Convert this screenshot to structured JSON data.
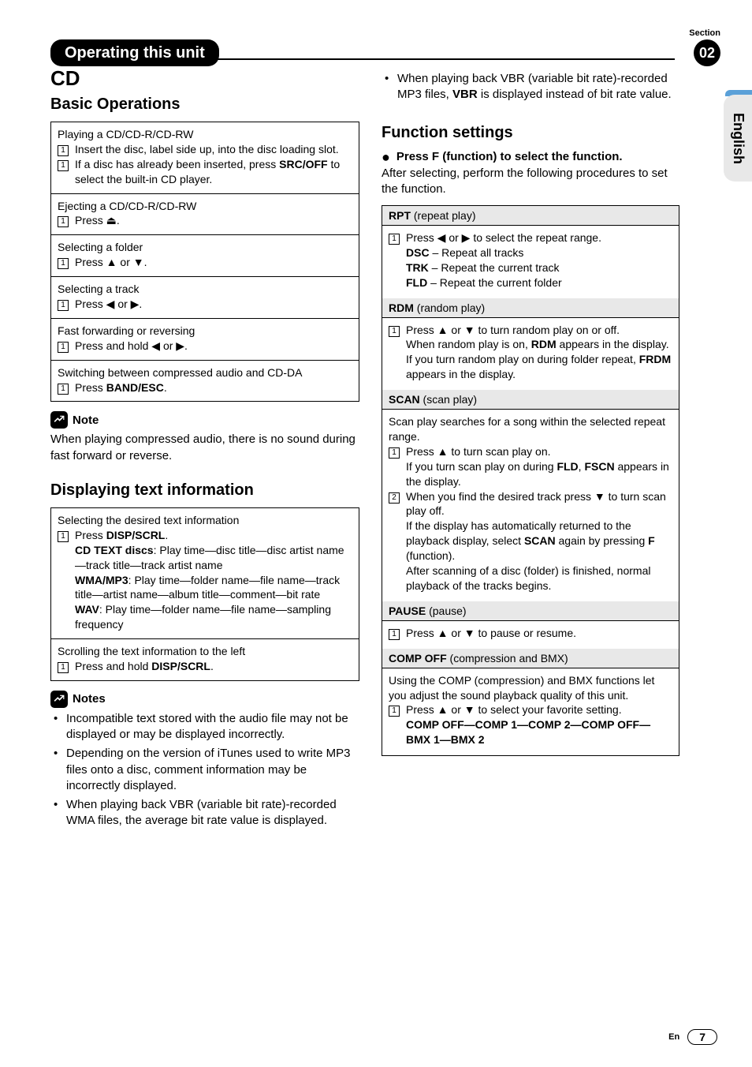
{
  "header": {
    "title": "Operating this unit",
    "section_label": "Section",
    "section_num": "02"
  },
  "sidetab": "English",
  "left": {
    "h1": "CD",
    "h2a": "Basic Operations",
    "box1": {
      "r1_title": "Playing a CD/CD-R/CD-RW",
      "r1_s1": "Insert the disc, label side up, into the disc loading slot.",
      "r1_s2a": "If a disc has already been inserted, press ",
      "r1_s2b": "SRC/OFF",
      "r1_s2c": " to select the built-in CD player.",
      "r2_title": "Ejecting a CD/CD-R/CD-RW",
      "r2_s1": "Press ⏏.",
      "r3_title": "Selecting a folder",
      "r3_s1": "Press ▲ or ▼.",
      "r4_title": "Selecting a track",
      "r4_s1": "Press ◀ or ▶.",
      "r5_title": "Fast forwarding or reversing",
      "r5_s1": "Press and hold ◀ or ▶.",
      "r6_title": "Switching between compressed audio and CD-DA",
      "r6_s1a": "Press ",
      "r6_s1b": "BAND/ESC",
      "r6_s1c": "."
    },
    "note1_label": "Note",
    "note1_body": "When playing compressed audio, there is no sound during fast forward or reverse.",
    "h2b": "Displaying text information",
    "box2": {
      "r1_title": "Selecting the desired text information",
      "r1_s1a": "Press ",
      "r1_s1b": "DISP/SCRL",
      "r1_s1c": ".",
      "r1_l1a": "CD TEXT discs",
      "r1_l1b": ": Play time—disc title—disc artist name—track title—track artist name",
      "r1_l2a": "WMA/MP3",
      "r1_l2b": ": Play time—folder name—file name—track title—artist name—album title—comment—bit rate",
      "r1_l3a": "WAV",
      "r1_l3b": ": Play time—folder name—file name—sampling frequency",
      "r2_title": "Scrolling the text information to the left",
      "r2_s1a": "Press and hold ",
      "r2_s1b": "DISP/SCRL",
      "r2_s1c": "."
    },
    "notes_label": "Notes",
    "notes": [
      "Incompatible text stored with the audio file may not be displayed or may be displayed incorrectly.",
      "Depending on the version of iTunes used to write MP3 files onto a disc, comment information may be incorrectly displayed.",
      "When playing back VBR (variable bit rate)-recorded WMA files, the average bit rate value is displayed."
    ]
  },
  "right": {
    "top_bullet_a": "When playing back VBR (variable bit rate)-recorded MP3 files, ",
    "top_bullet_b": "VBR",
    "top_bullet_c": " is displayed instead of bit rate value.",
    "h2": "Function settings",
    "fhead": "Press F (function) to select the function.",
    "fbody": "After selecting, perform the following procedures to set the function.",
    "rpt": {
      "bar_a": "RPT",
      "bar_b": " (repeat play)",
      "s1": "Press ◀ or ▶ to select the repeat range.",
      "l1a": "DSC",
      "l1b": " – Repeat all tracks",
      "l2a": "TRK",
      "l2b": " – Repeat the current track",
      "l3a": "FLD",
      "l3b": " – Repeat the current folder"
    },
    "rdm": {
      "bar_a": "RDM",
      "bar_b": " (random play)",
      "s1": "Press ▲ or ▼ to turn random play on or off.",
      "s1b_a": "When random play is on, ",
      "s1b_b": "RDM",
      "s1b_c": " appears in the display.",
      "s1c_a": "If you turn random play on during folder repeat, ",
      "s1c_b": "FRDM",
      "s1c_c": " appears in the display."
    },
    "scan": {
      "bar_a": "SCAN",
      "bar_b": " (scan play)",
      "intro": "Scan play searches for a song within the selected repeat range.",
      "s1": "Press ▲ to turn scan play on.",
      "s1b_a": "If you turn scan play on during ",
      "s1b_b": "FLD",
      "s1b_c": ", ",
      "s1b_d": "FSCN",
      "s1b_e": " appears in the display.",
      "s2": "When you find the desired track press ▼ to turn scan play off.",
      "s2b_a": "If the display has automatically returned to the playback display, select ",
      "s2b_b": "SCAN",
      "s2b_c": " again by pressing ",
      "s2b_d": "F",
      "s2b_e": " (function).",
      "s2c": "After scanning of a disc (folder) is finished, normal playback of the tracks begins."
    },
    "pause": {
      "bar_a": "PAUSE",
      "bar_b": " (pause)",
      "s1": "Press ▲ or ▼ to pause or resume."
    },
    "comp": {
      "bar_a": "COMP OFF",
      "bar_b": " (compression and BMX)",
      "intro": "Using the COMP (compression) and BMX functions let you adjust the sound playback quality of this unit.",
      "s1": "Press ▲ or ▼ to select your favorite setting.",
      "seq": "COMP OFF—COMP 1—COMP 2—COMP OFF—BMX 1—BMX 2"
    }
  },
  "footer": {
    "lang": "En",
    "page": "7"
  },
  "num1": "1",
  "num2": "2"
}
